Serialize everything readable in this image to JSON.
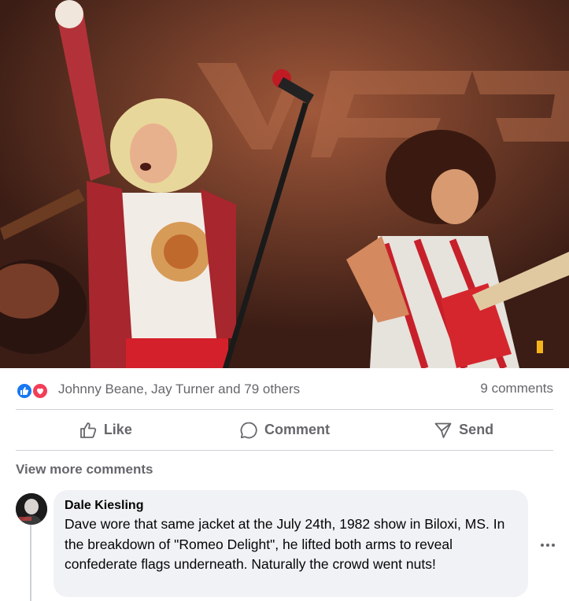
{
  "post": {
    "photo": {
      "icon": "concert-photo"
    },
    "reactions": {
      "names": "Johnny Beane, Jay Turner and 79 others",
      "icons": [
        "like-icon",
        "love-icon"
      ],
      "like_color": "#1877f2",
      "love_color": "#f33e58"
    },
    "comments_count": "9 comments",
    "actions": {
      "like_label": "Like",
      "comment_label": "Comment",
      "send_label": "Send"
    }
  },
  "comments": {
    "view_more_label": "View more comments",
    "items": [
      {
        "author": "Dale Kiesling",
        "text": "Dave wore that same jacket at the July 24th, 1982 show in Biloxi, MS. In the breakdown of \"Romeo Delight\", he lifted both arms to reveal confederate flags underneath. Naturally the crowd went nuts!"
      }
    ]
  },
  "colors": {
    "secondary_text": "#65676b",
    "bubble_bg": "#f0f2f5",
    "divider": "#ced0d4"
  }
}
